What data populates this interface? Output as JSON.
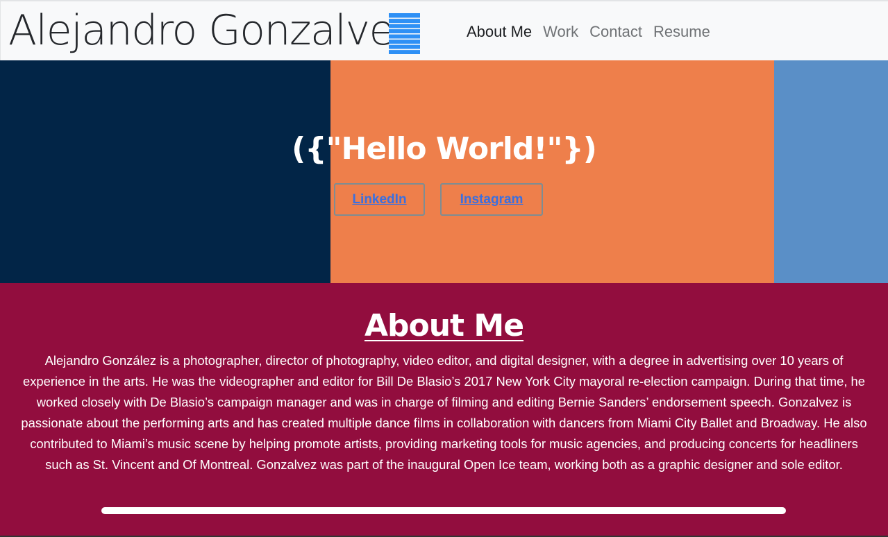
{
  "navbar": {
    "brand": "Alejandro Gonzalvez",
    "menu_icon": "hamburger-menu-icon",
    "links": [
      {
        "label": "About Me",
        "active": true
      },
      {
        "label": "Work",
        "active": false
      },
      {
        "label": "Contact",
        "active": false
      },
      {
        "label": "Resume",
        "active": false
      }
    ]
  },
  "hero": {
    "title": "({\"Hello World!\"})",
    "buttons": {
      "linkedin": "LinkedIn",
      "instagram": "Instagram"
    },
    "colors": {
      "navy": "#022547",
      "orange": "#ee7f4b",
      "blue": "#5a8fc7"
    }
  },
  "about": {
    "title": "About Me",
    "body": "Alejandro González is a photographer, director of photography, video editor, and digital designer, with a degree in advertising over 10 years of experience in the arts. He was the videographer and editor for Bill De Blasio’s 2017 New York City mayoral re-election campaign. During that time, he worked closely with De Blasio’s campaign manager and was in charge of filming and editing Bernie Sanders’ endorsement speech. Gonzalvez is passionate about the performing arts and has created multiple dance films in collaboration with dancers from Miami City Ballet and Broadway. He also contributed to Miami’s music scene by helping promote artists, providing marketing tools for music agencies, and producing concerts for headliners such as St. Vincent and Of Montreal. Gonzalvez was part of the inaugural Open Ice team, working both as a graphic designer and sole editor.",
    "background": "#920d3e"
  }
}
